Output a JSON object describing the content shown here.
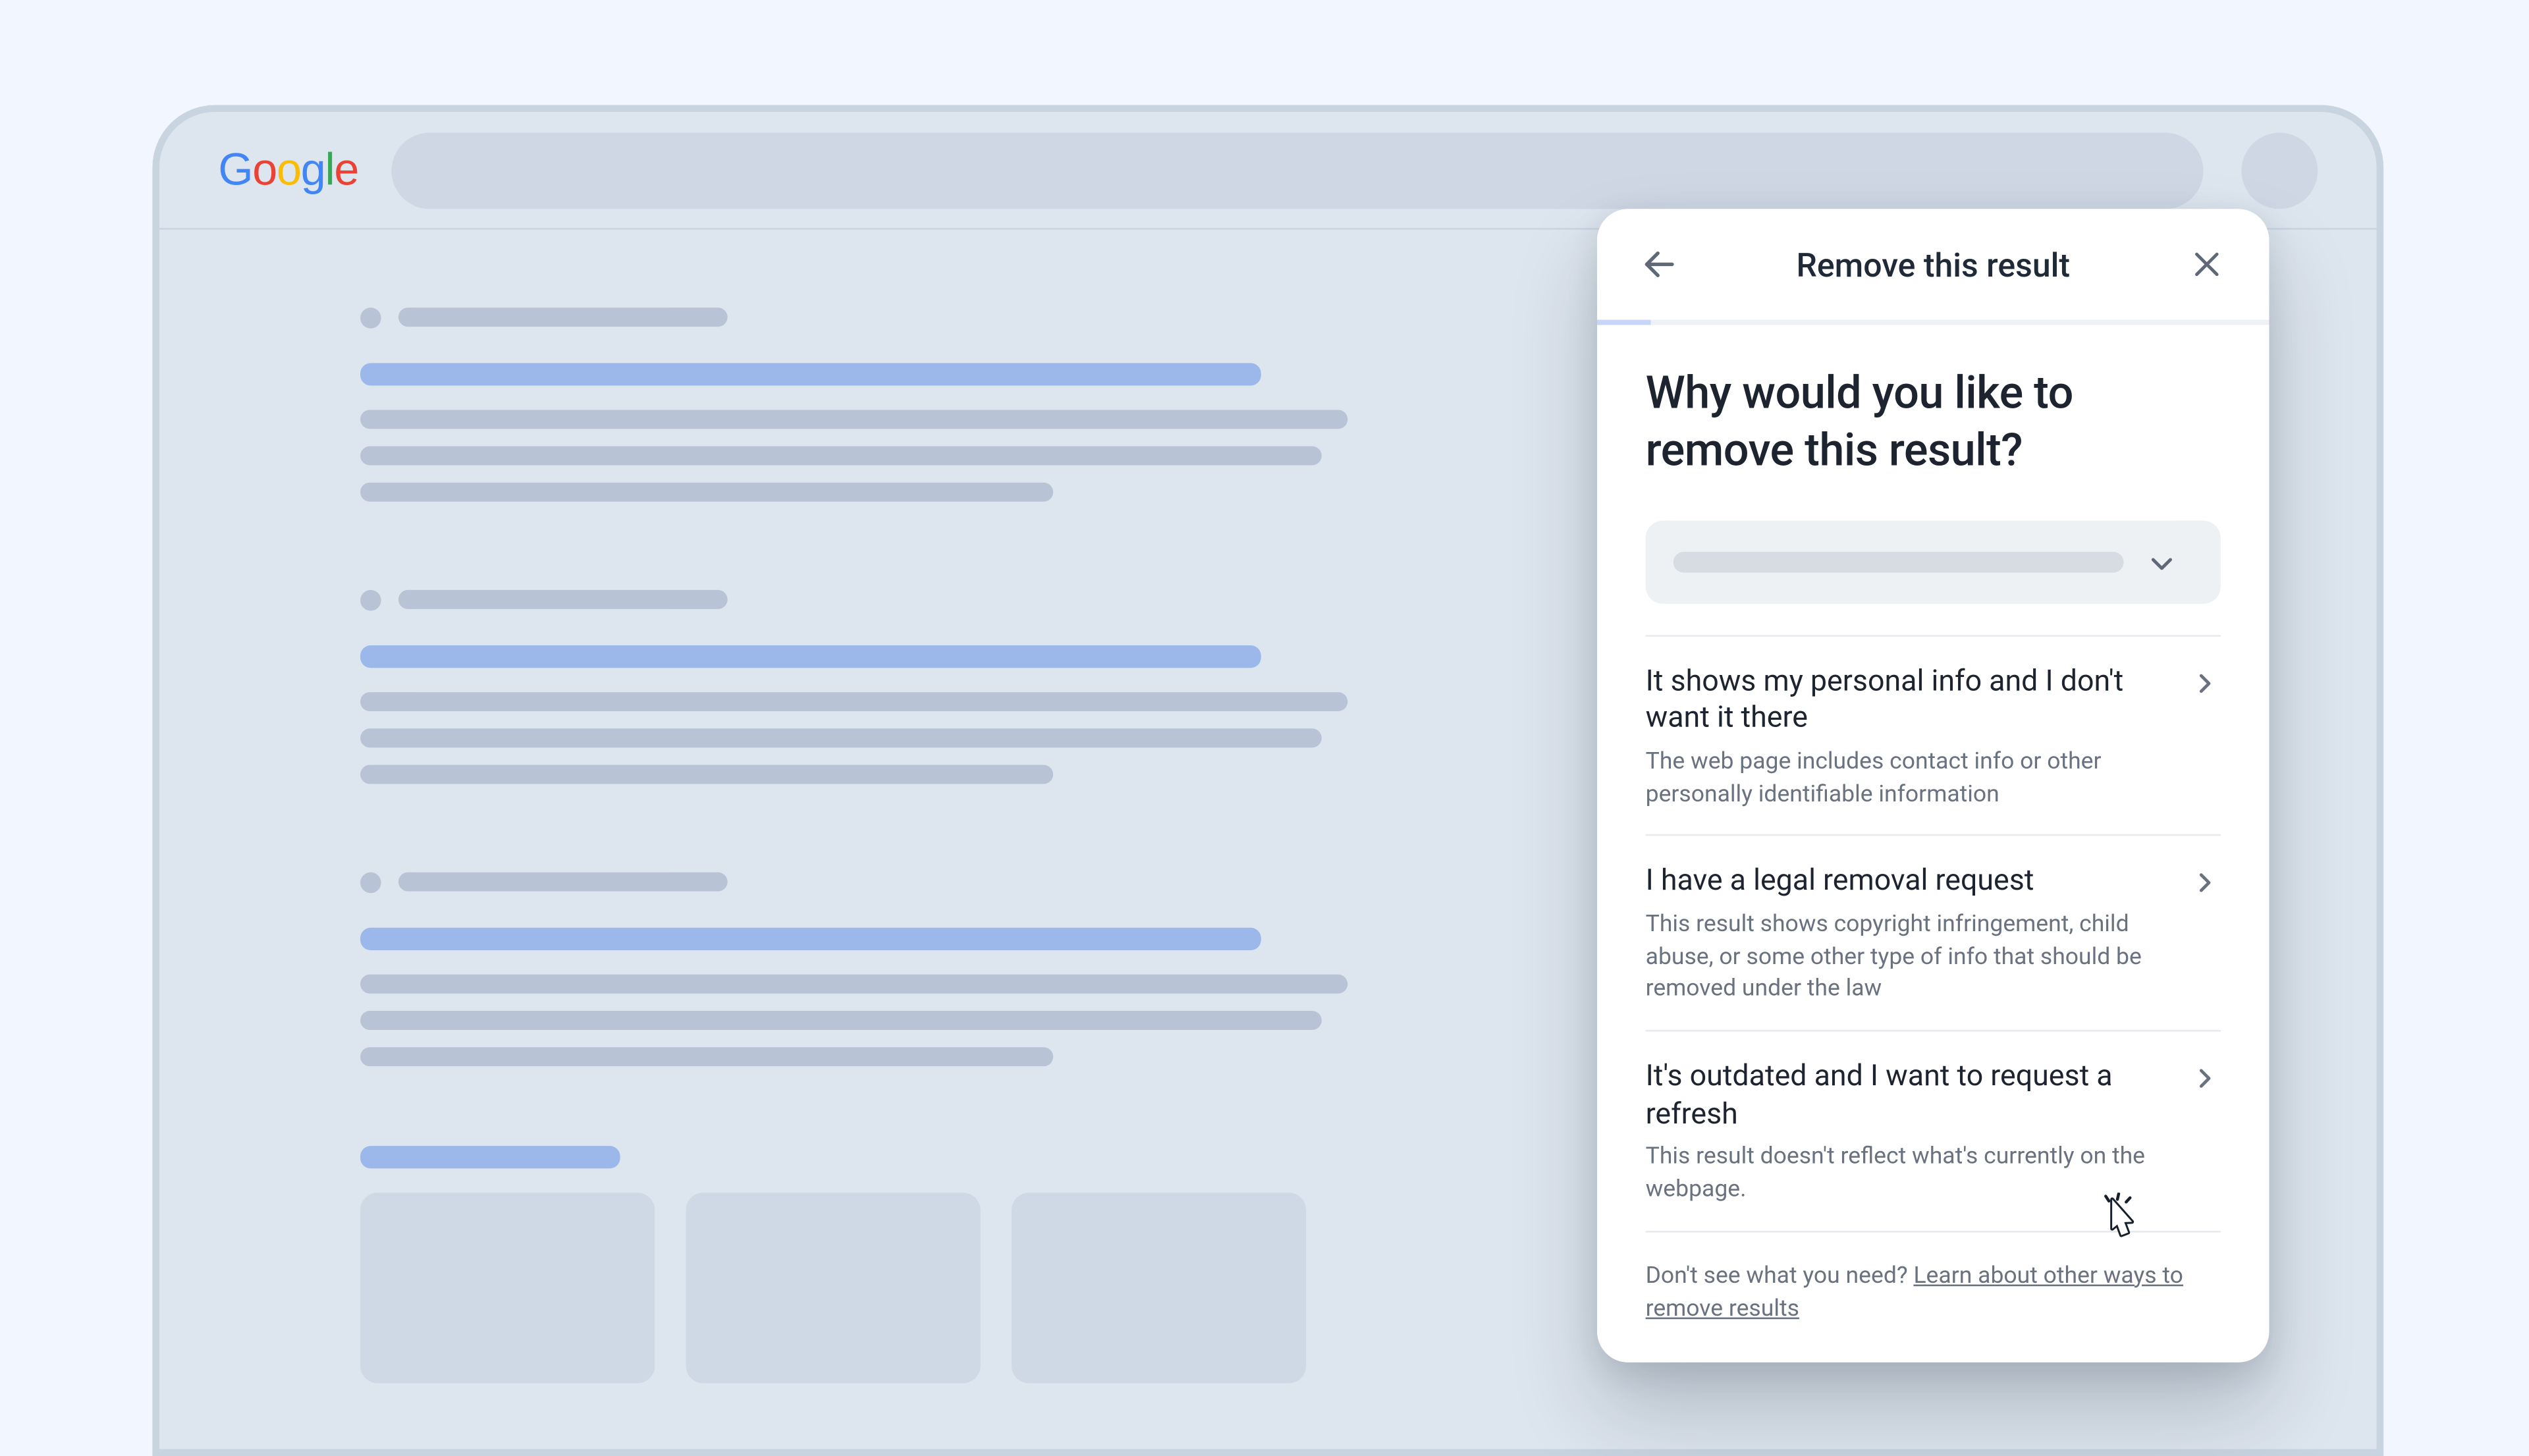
{
  "header": {
    "logo_text": "Google"
  },
  "panel": {
    "title": "Remove this result",
    "question": "Why would you like to remove this result?",
    "options": [
      {
        "title": "It shows my personal info and I don't want it there",
        "desc": "The web page includes contact info or other personally identifiable information"
      },
      {
        "title": "I have a legal removal request",
        "desc": "This result shows copyright infringement, child abuse, or some other type of info that should be removed under the law"
      },
      {
        "title": "It's outdated and I want to request a refresh",
        "desc": "This result doesn't reflect what's currently on the webpage."
      }
    ],
    "footer_lead": "Don't see what you need? ",
    "footer_link": "Learn about other ways to remove results"
  }
}
